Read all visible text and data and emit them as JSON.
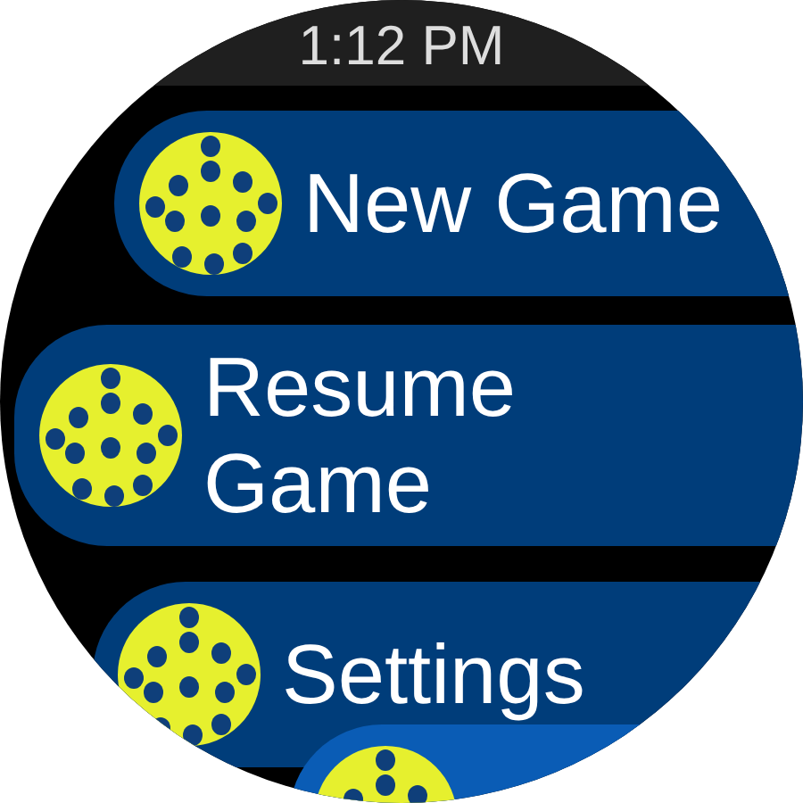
{
  "status_bar": {
    "time": "1:12 PM"
  },
  "menu": [
    {
      "label": "New Game",
      "highlighted": false
    },
    {
      "label": "Resume Game",
      "highlighted": false
    },
    {
      "label": "Settings",
      "highlighted": false
    },
    {
      "highlighted": true
    }
  ]
}
